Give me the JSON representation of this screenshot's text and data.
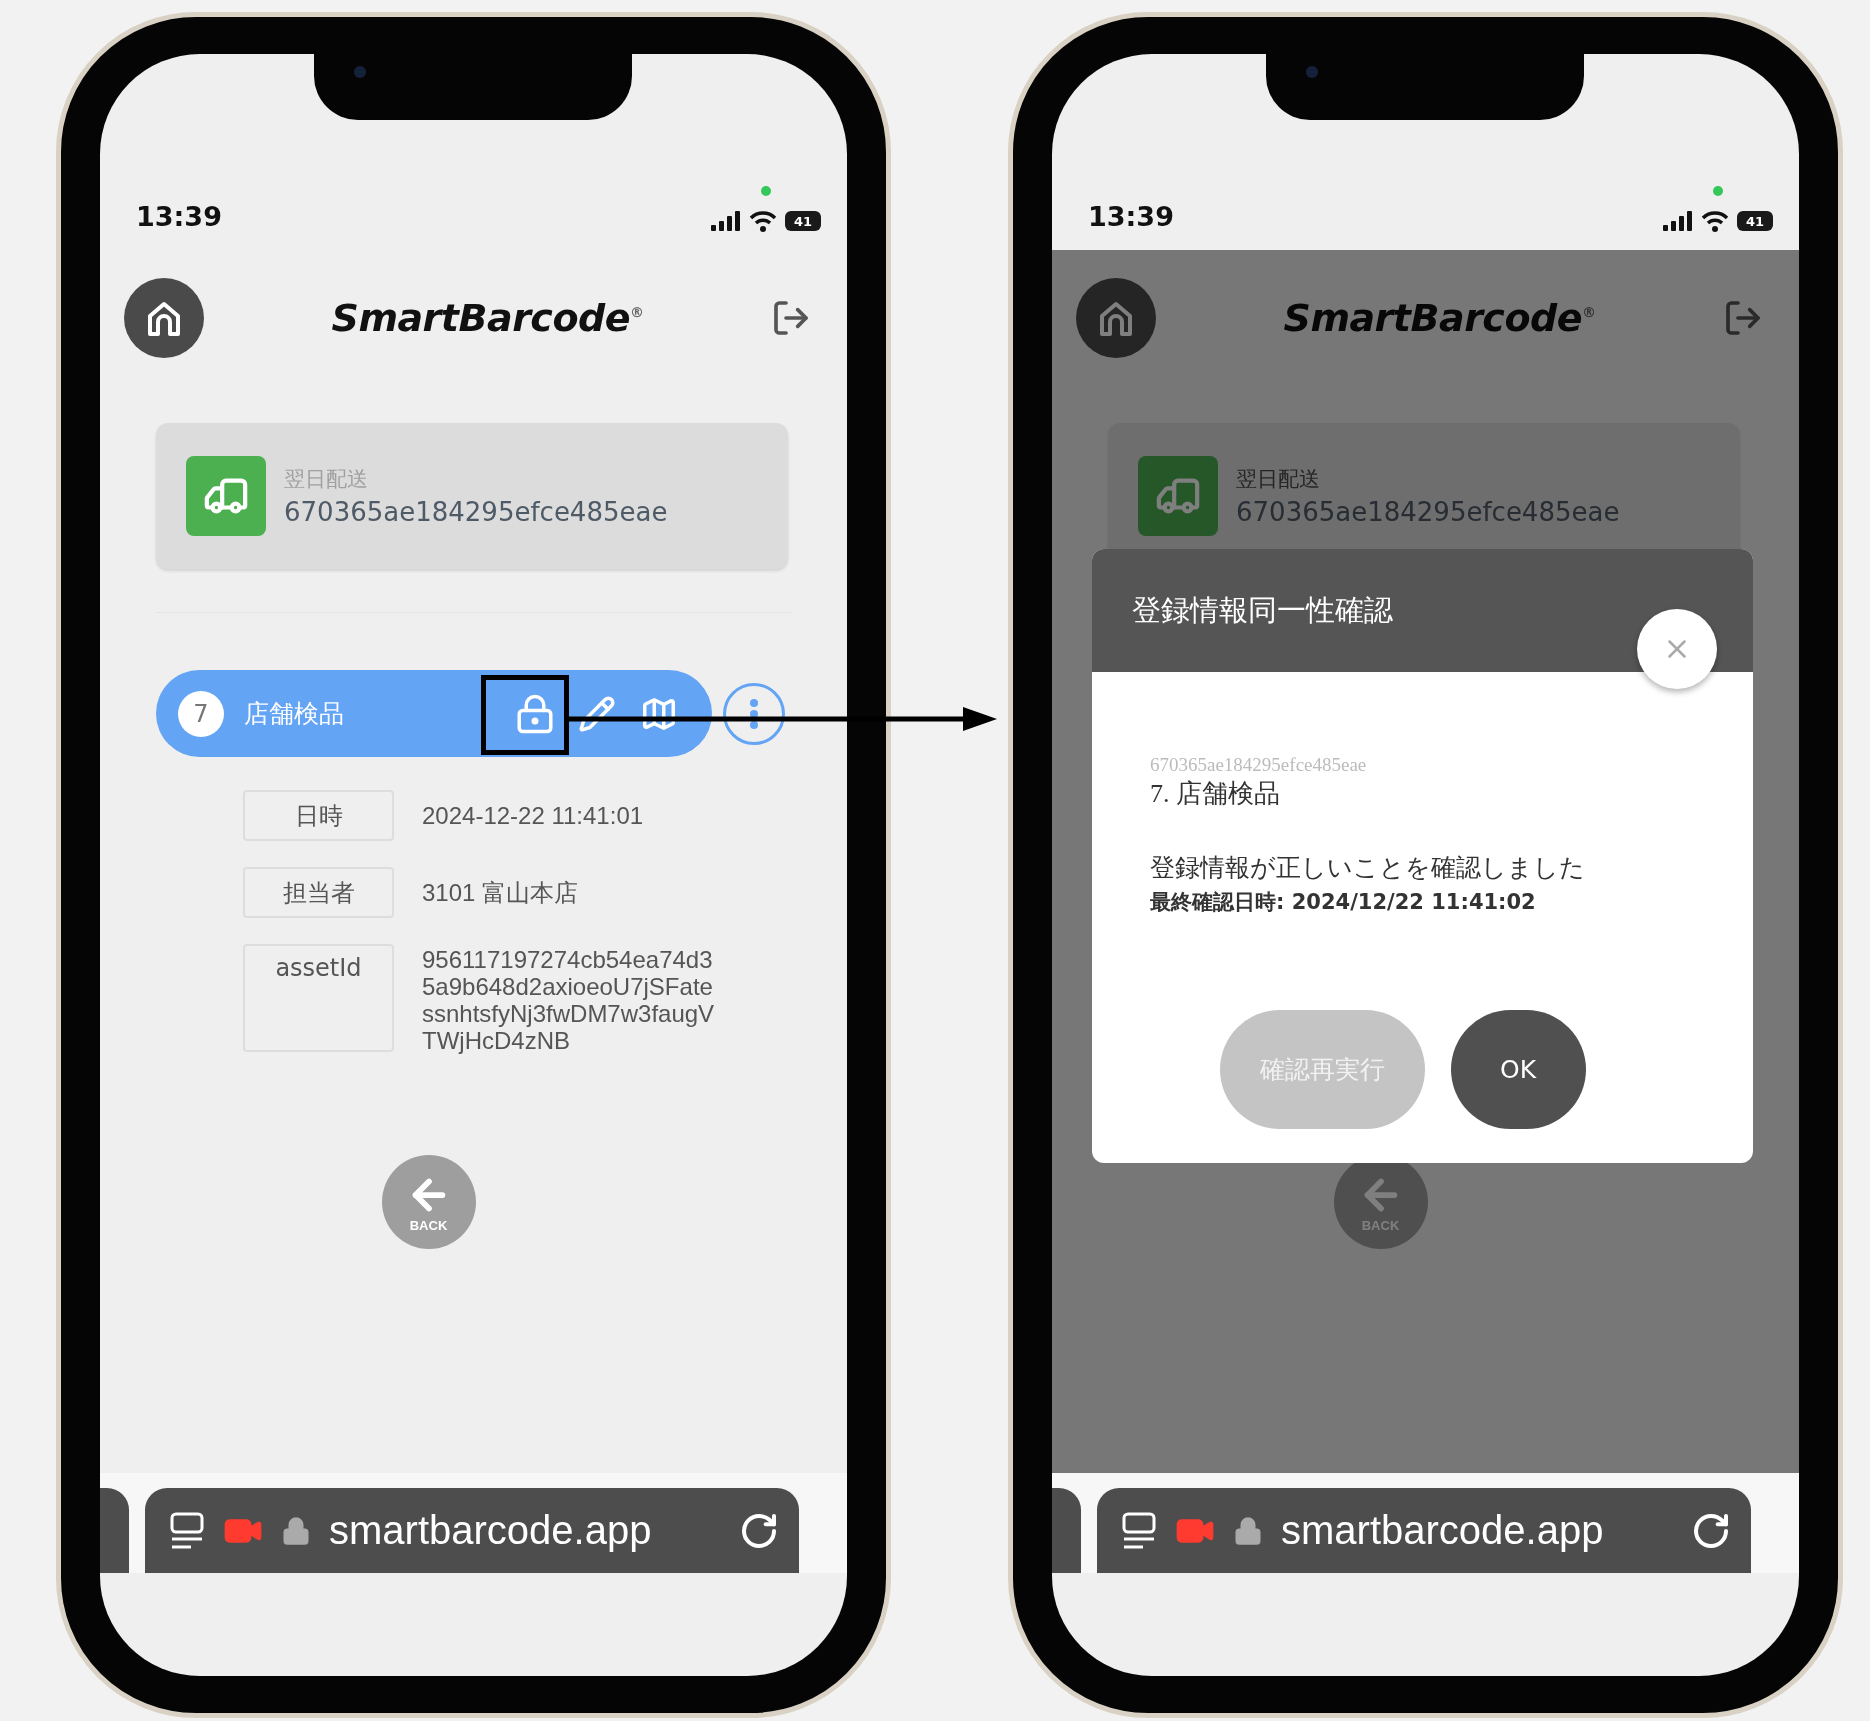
{
  "phones": [
    {
      "dimmed": false,
      "status_bar": {
        "time": "13:39",
        "battery": "41"
      },
      "header": {
        "title": "SmartBarcode$^{®}$"
      },
      "card": {
        "category": "翌日配送",
        "id": "670365ae184295efce485eae"
      },
      "step": {
        "number": "7",
        "label": "店舗検品"
      },
      "details": [
        {
          "label": "日時",
          "value": "2024-12-22 11:41:01"
        },
        {
          "label": "担当者",
          "value": "3101 富山本店"
        },
        {
          "label": "assetId",
          "value": "956117197274cb54ea74d35a9b648d2axioeoU7jSFatessnhtsfyNj3fwDM7w3faugVTWjHcD4zNB"
        }
      ],
      "back_button": {
        "label": "BACK"
      },
      "browser": {
        "url": "smartbarcode.app"
      }
    },
    {
      "dimmed": true,
      "status_bar": {
        "time": "13:39",
        "battery": "41"
      },
      "header": {
        "title": "SmartBarcode$^{®}$"
      },
      "card": {
        "category": "翌日配送",
        "id": "670365ae184295efce485eae"
      },
      "back_button": {
        "label": "BACK"
      },
      "browser": {
        "url": "smartbarcode.app"
      },
      "dialog": {
        "title": "登録情報同一性確認",
        "record_id": "670365ae184295efce485eae",
        "step": "7. 店舗検品",
        "message": "登録情報が正しいことを確認しました",
        "last_checked": "最終確認日時: 2024/12/22 11:41:02",
        "buttons": [
          {
            "label": "確認再実行",
            "disabled": true
          },
          {
            "label": "OK",
            "disabled": false
          }
        ]
      }
    }
  ]
}
